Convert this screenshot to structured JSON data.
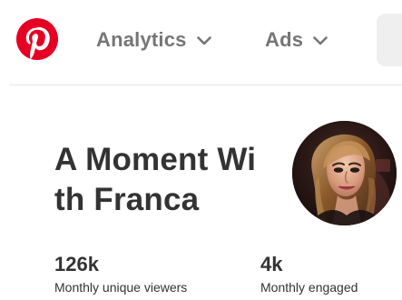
{
  "header": {
    "logo_icon": "pinterest-icon",
    "nav": [
      {
        "label": "Analytics",
        "icon": "chevron-down-icon"
      },
      {
        "label": "Ads",
        "icon": "chevron-down-icon"
      }
    ]
  },
  "profile": {
    "title_line1": "A Moment Wi",
    "title_line2": "th Franca",
    "avatar_icon": "profile-photo"
  },
  "stats": [
    {
      "value": "126k",
      "label": "Monthly unique viewers"
    },
    {
      "value": "4k",
      "label": "Monthly engaged"
    }
  ],
  "colors": {
    "brand": "#e60023",
    "nav_text": "#767676",
    "text": "#333333"
  }
}
